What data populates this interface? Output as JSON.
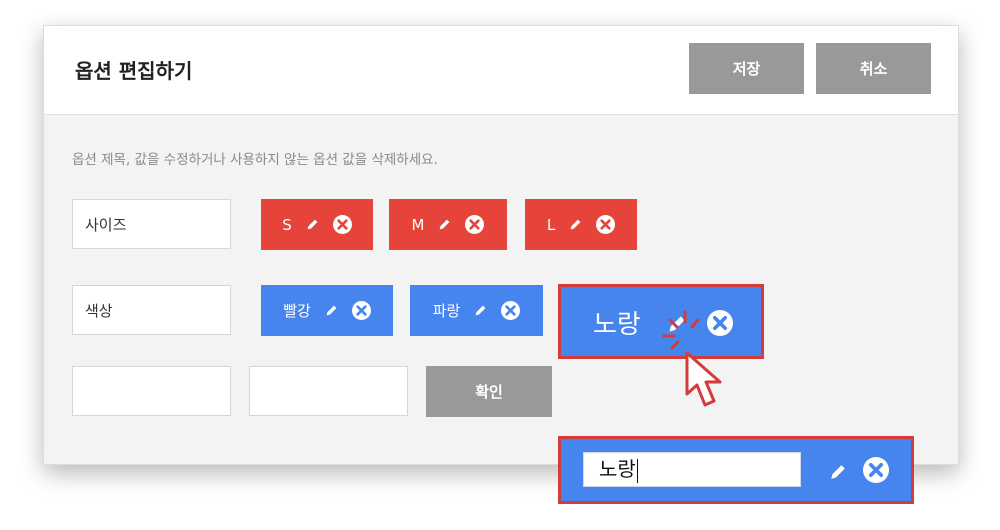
{
  "dialog": {
    "title": "옵션 편집하기",
    "save_label": "저장",
    "cancel_label": "취소",
    "description": "옵션 제목, 값을 수정하거나 사용하지 않는 옵션 값을 삭제하세요."
  },
  "options": [
    {
      "name": "사이즈",
      "values": [
        "S",
        "M",
        "L"
      ]
    },
    {
      "name": "색상",
      "values": [
        "빨강",
        "파랑",
        "노랑"
      ]
    }
  ],
  "new_option": {
    "name": "",
    "value": "",
    "confirm_label": "확인"
  },
  "edit_value": "노랑",
  "colors": {
    "red_chip": "#e6433a",
    "blue_chip": "#4785ee",
    "gray_button": "#999999",
    "highlight": "#d53b3b"
  },
  "icons": [
    "pencil-icon",
    "close-circle-icon",
    "mouse-pointer-icon"
  ]
}
